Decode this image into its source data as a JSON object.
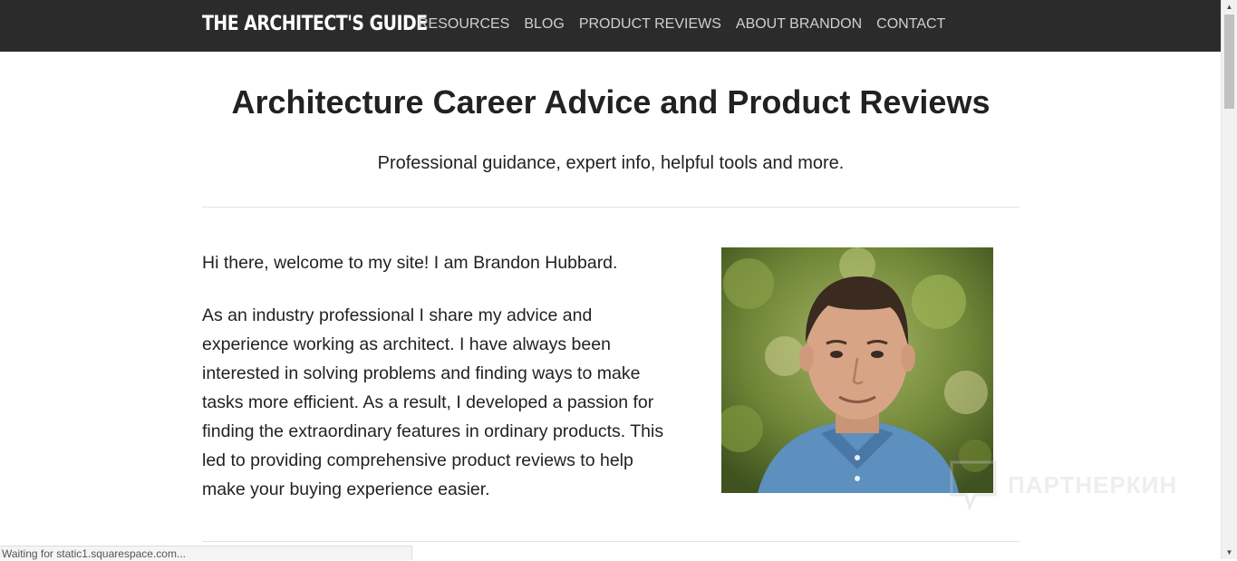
{
  "header": {
    "logo": "THE ARCHITECT'S GUIDE",
    "nav": [
      {
        "label": "RESOURCES"
      },
      {
        "label": "BLOG"
      },
      {
        "label": "PRODUCT REVIEWS"
      },
      {
        "label": "ABOUT BRANDON"
      },
      {
        "label": "CONTACT"
      }
    ]
  },
  "hero": {
    "title": "Architecture Career Advice and Product Reviews",
    "subtitle": "Professional guidance, expert info, helpful tools and more."
  },
  "intro": {
    "greeting": "Hi there, welcome to my site! I am Brandon Hubbard.",
    "paragraph": "As an industry professional I share my advice and experience working as architect. I have always been interested in solving problems and finding ways to make tasks more efficient. As a result, I developed a passion for finding the extraordinary features in ordinary products. This led to providing comprehensive product reviews to help make your buying experience easier."
  },
  "watermark": {
    "text": "ПАРТНЕРКИН"
  },
  "status_bar": {
    "text": "Waiting for static1.squarespace.com..."
  },
  "colors": {
    "header_bg": "#2b2b2b",
    "nav_text": "#cfcfcf",
    "body_text": "#222222"
  }
}
